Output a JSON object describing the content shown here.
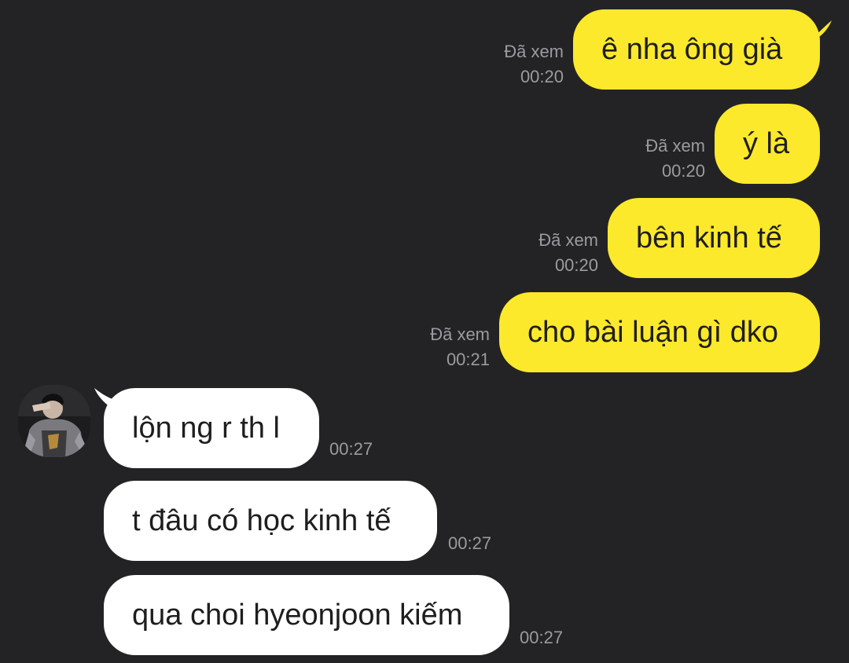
{
  "conversation": {
    "outgoing": [
      {
        "text": "ê nha ông già",
        "status": "Đã xem",
        "time": "00:20"
      },
      {
        "text": "ý là",
        "status": "Đã xem",
        "time": "00:20"
      },
      {
        "text": "bên kinh tế",
        "status": "Đã xem",
        "time": "00:20"
      },
      {
        "text": "cho bài luận gì dko",
        "status": "Đã xem",
        "time": "00:21"
      }
    ],
    "incoming": [
      {
        "text": "lộn ng r th l",
        "time": "00:27"
      },
      {
        "text": "t đâu có học kinh tế",
        "time": "00:27"
      },
      {
        "text": "qua choi hyeonjoon kiếm",
        "time": "00:27"
      }
    ]
  },
  "colors": {
    "background": "#232325",
    "outgoing_bubble": "#fde92b",
    "incoming_bubble": "#ffffff",
    "meta_text": "#9b9b9f"
  },
  "icons": {
    "avatar": "contact-avatar-photo"
  }
}
